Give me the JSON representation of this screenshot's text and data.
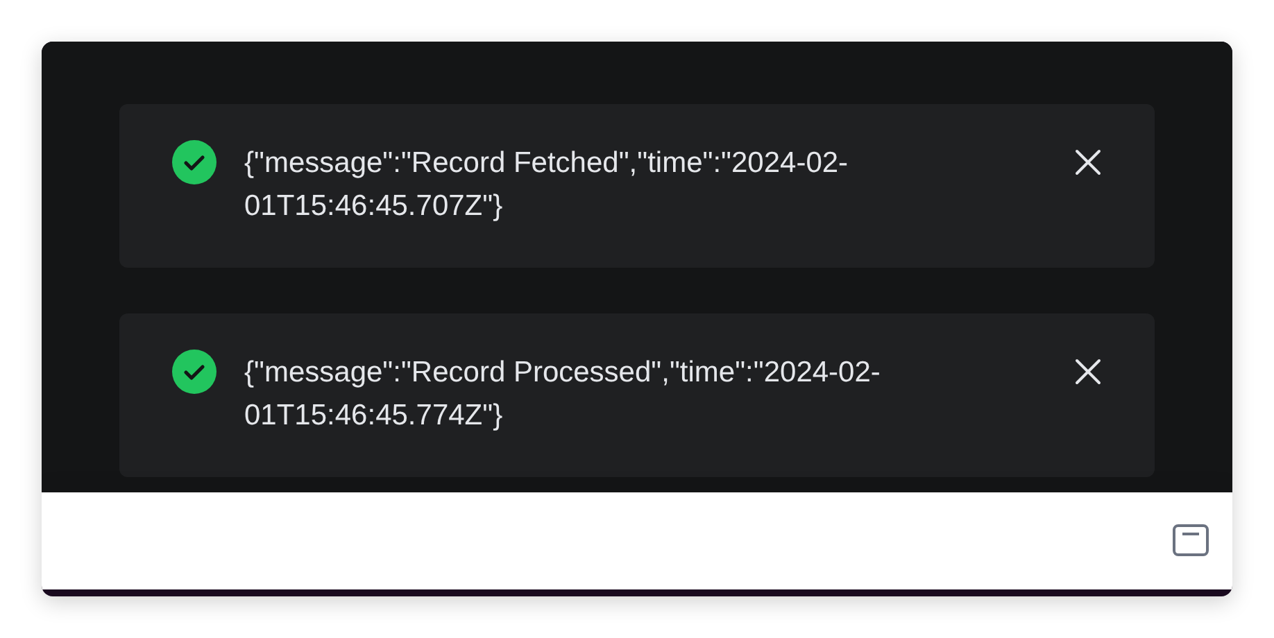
{
  "notifications": [
    {
      "kind": "success",
      "message": "{\"message\":\"Record Fetched\",\"time\":\"2024-02-01T15:46:45.707Z\"}"
    },
    {
      "kind": "success",
      "message": "{\"message\":\"Record Processed\",\"time\":\"2024-02-01T15:46:45.774Z\"}"
    }
  ]
}
